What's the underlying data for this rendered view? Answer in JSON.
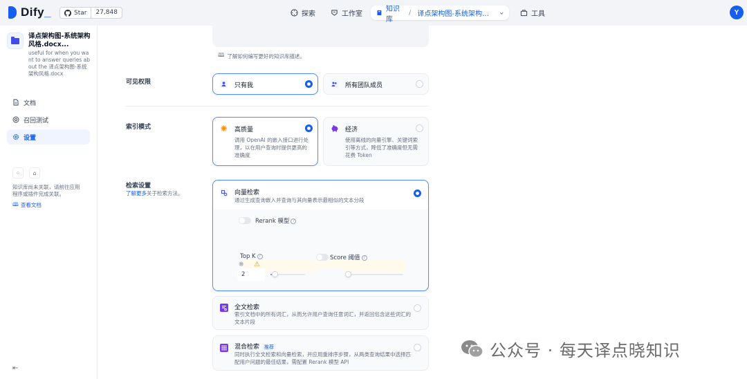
{
  "brand": {
    "name": "Dify",
    "accent": "#155eef"
  },
  "github": {
    "star_label": "Star",
    "count": "27,848"
  },
  "nav": {
    "explore": "探索",
    "studio": "工作室",
    "knowledge": "知识库",
    "breadcrumb": "译点架构图-系统架构风格.docx",
    "tools": "工具"
  },
  "user": {
    "avatar_letter": "Y"
  },
  "sidebar": {
    "dataset_title": "译点架构图-系统架构风格.docx...",
    "dataset_desc": "useful for when you want to answer queries about the 译点架构图-系统架构风格.docx",
    "items": [
      {
        "label": "文档",
        "icon": "document-icon"
      },
      {
        "label": "召回测试",
        "icon": "target-icon"
      },
      {
        "label": "设置",
        "icon": "gear-icon",
        "active": true
      }
    ],
    "note": "知识库尚未关联，请前往应用程序或插件完成关联。",
    "doc_link": "查看文档"
  },
  "main": {
    "desc_hint": "了解如何编写更好的知识库描述。",
    "permission": {
      "label": "可见权限",
      "options": [
        {
          "label": "只有我",
          "selected": true
        },
        {
          "label": "所有团队成员",
          "selected": false
        }
      ]
    },
    "index_mode": {
      "label": "索引模式",
      "options": [
        {
          "label": "高质量",
          "desc": "调用 OpenAI 的嵌入接口进行处理，以在用户查询时提供更高的准确度",
          "selected": true
        },
        {
          "label": "经济",
          "desc": "使用离线的向量引擎、关键词索引等方式，降低了准确度但无需花费 Token",
          "selected": false
        }
      ]
    },
    "retrieval": {
      "label": "检索设置",
      "learn_more": "了解更多",
      "learn_more_suffix": "关于检索方法。",
      "vector": {
        "label": "向量检索",
        "desc": "通过生成查询嵌入并查询与其向量表示最相似的文本分段",
        "selected": true,
        "rerank_label": "Rerank 模型",
        "topk_label": "Top K",
        "topk_value": "2",
        "topk_fraction": 0.04,
        "score_label": "Score 阈值",
        "score_fraction": 0.0
      },
      "fulltext": {
        "label": "全文检索",
        "desc": "索引文档中的所有词汇，从而允许用户查询任意词汇，并返回包含这些词汇的文本片段",
        "selected": false
      },
      "hybrid": {
        "label": "混合检索",
        "tag": "推荐",
        "desc": "同时执行全文检索和向量检索，并应用重排序步骤，从两类查询结果中选择匹配用户问题的最佳结果，需配置 Rerank 模型 API",
        "selected": false
      }
    }
  },
  "watermark": "公众号 · 每天译点晓知识"
}
